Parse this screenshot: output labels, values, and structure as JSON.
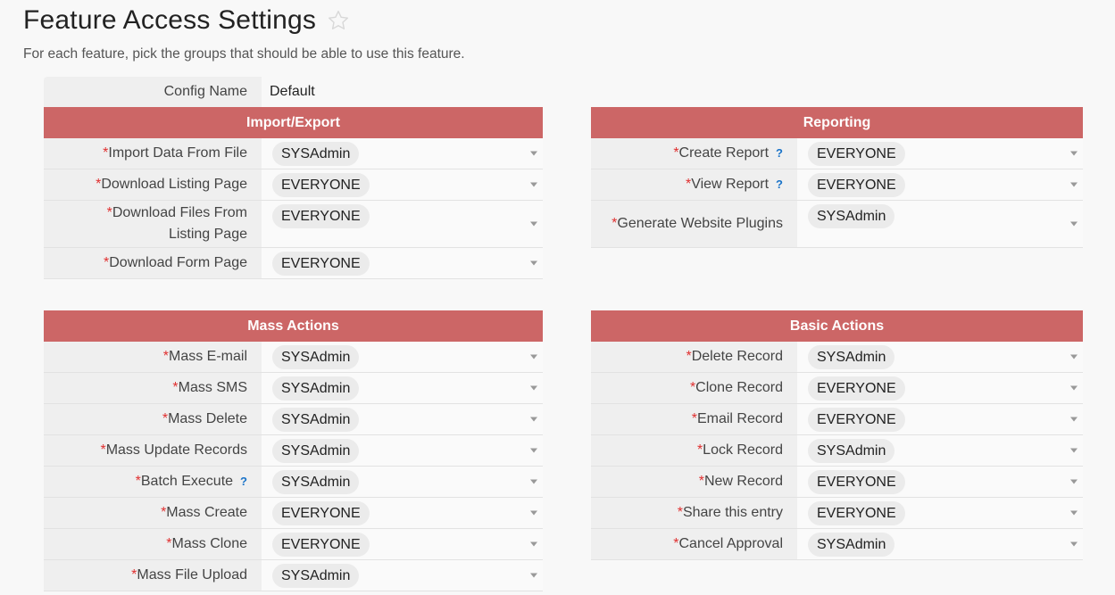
{
  "page": {
    "title": "Feature Access Settings",
    "subtitle": "For each feature, pick the groups that should be able to use this feature."
  },
  "config": {
    "label": "Config Name",
    "value": "Default"
  },
  "sections": {
    "import_export": {
      "title": "Import/Export",
      "rows": [
        {
          "label": "Import Data From File",
          "value": "SYSAdmin"
        },
        {
          "label": "Download Listing Page",
          "value": "EVERYONE"
        },
        {
          "label_line1": "Download Files From",
          "label_line2": "Listing Page",
          "value": "EVERYONE"
        },
        {
          "label": "Download Form Page",
          "value": "EVERYONE"
        }
      ]
    },
    "reporting": {
      "title": "Reporting",
      "rows": [
        {
          "label": "Create Report",
          "value": "EVERYONE",
          "help": "?"
        },
        {
          "label": "View Report",
          "value": "EVERYONE",
          "help": "?"
        },
        {
          "label": "Generate Website Plugins",
          "value": "SYSAdmin"
        }
      ]
    },
    "mass_actions": {
      "title": "Mass Actions",
      "rows": [
        {
          "label": "Mass E-mail",
          "value": "SYSAdmin"
        },
        {
          "label": "Mass SMS",
          "value": "SYSAdmin"
        },
        {
          "label": "Mass Delete",
          "value": "SYSAdmin"
        },
        {
          "label": "Mass Update Records",
          "value": "SYSAdmin"
        },
        {
          "label": "Batch Execute",
          "value": "SYSAdmin",
          "help": "?"
        },
        {
          "label": "Mass Create",
          "value": "EVERYONE"
        },
        {
          "label": "Mass Clone",
          "value": "EVERYONE"
        },
        {
          "label": "Mass File Upload",
          "value": "SYSAdmin"
        }
      ]
    },
    "basic_actions": {
      "title": "Basic Actions",
      "rows": [
        {
          "label": "Delete Record",
          "value": "SYSAdmin"
        },
        {
          "label": "Clone Record",
          "value": "EVERYONE"
        },
        {
          "label": "Email Record",
          "value": "EVERYONE"
        },
        {
          "label": "Lock Record",
          "value": "SYSAdmin"
        },
        {
          "label": "New Record",
          "value": "EVERYONE"
        },
        {
          "label": "Share this entry",
          "value": "EVERYONE"
        },
        {
          "label": "Cancel Approval",
          "value": "SYSAdmin"
        }
      ]
    }
  },
  "required_marker": "*",
  "colors": {
    "section_header": "#cc6666",
    "required": "#e03030",
    "help": "#1a73c8"
  },
  "icons": {
    "favorite": "star-icon",
    "dropdown": "caret-down-icon",
    "help": "question-icon"
  }
}
